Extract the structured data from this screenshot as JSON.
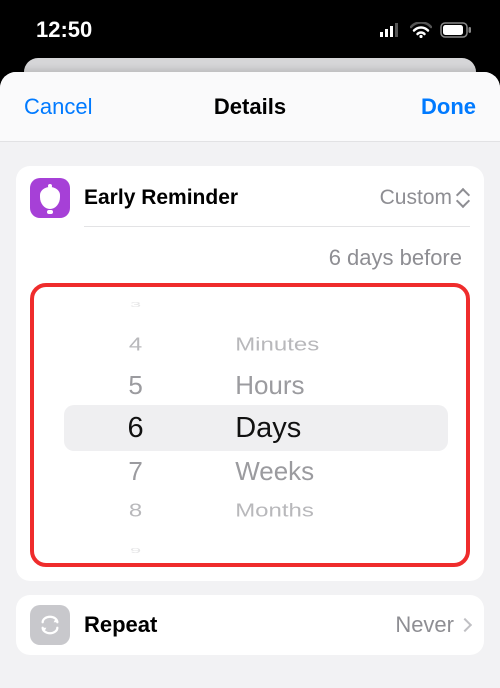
{
  "status": {
    "time": "12:50"
  },
  "header": {
    "cancel": "Cancel",
    "title": "Details",
    "done": "Done"
  },
  "early_reminder": {
    "label": "Early Reminder",
    "mode": "Custom",
    "summary": "6 days before"
  },
  "picker": {
    "numbers": {
      "m3": "3",
      "m2": "4",
      "m1": "5",
      "sel": "6",
      "p1": "7",
      "p2": "8",
      "p3": "9"
    },
    "units": {
      "m2": "Minutes",
      "m1": "Hours",
      "sel": "Days",
      "p1": "Weeks",
      "p2": "Months"
    }
  },
  "repeat": {
    "label": "Repeat",
    "value": "Never"
  }
}
